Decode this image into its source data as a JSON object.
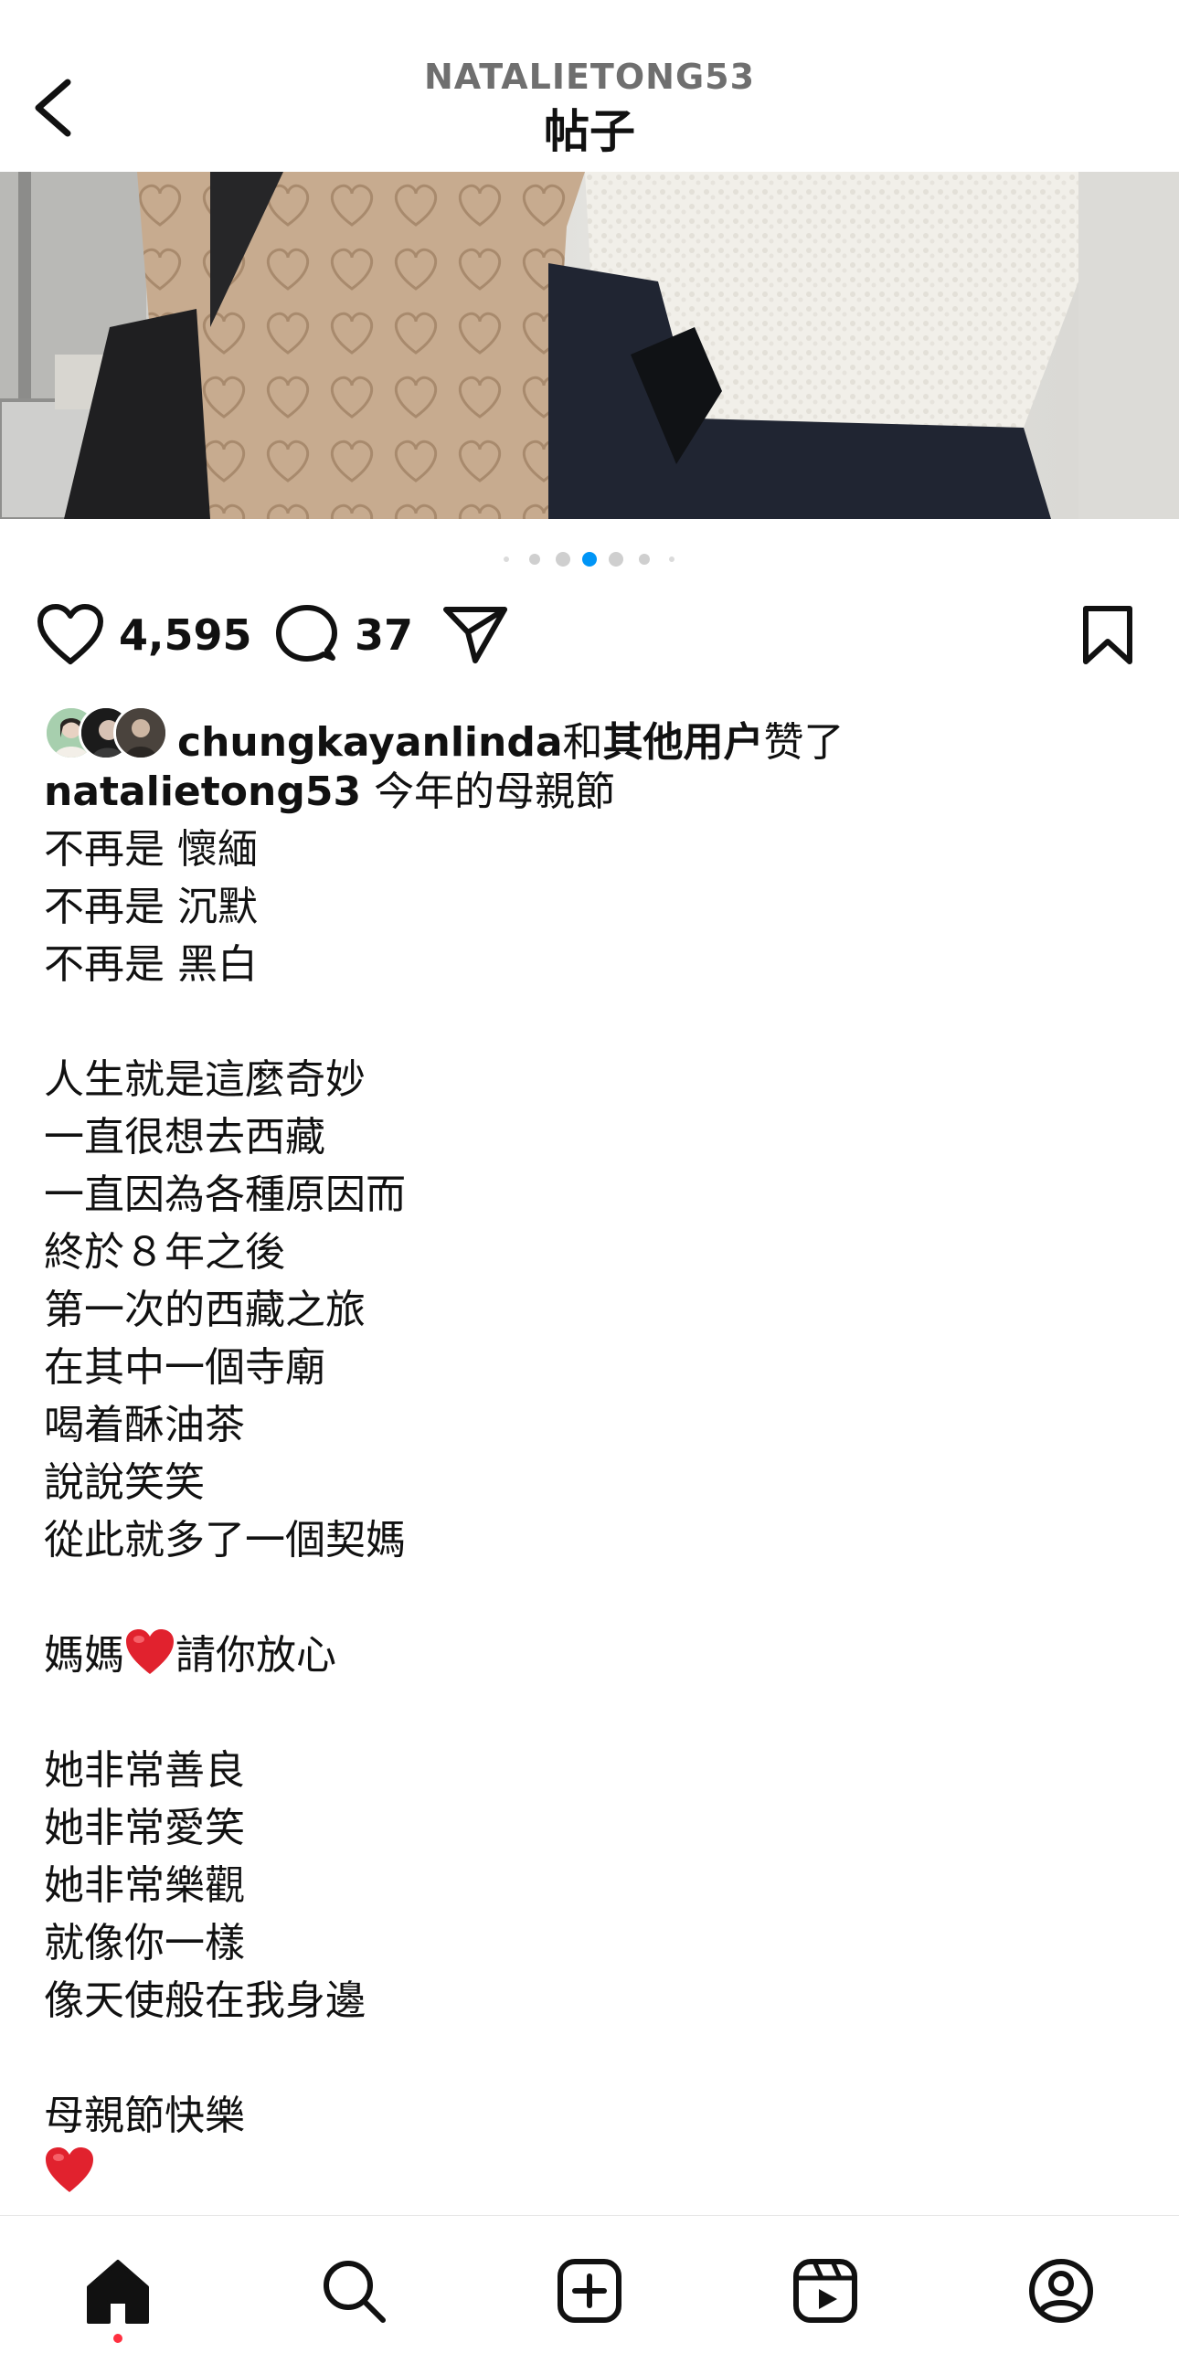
{
  "header": {
    "username": "NATALIETONG53",
    "title": "帖子",
    "back_icon": "chevron-left-icon"
  },
  "carousel": {
    "dot_count": 7,
    "active_index": 3,
    "accent": "#0095f6"
  },
  "actions": {
    "like_count": "4,595",
    "comment_count": "37",
    "icons": [
      "heart-icon",
      "comment-icon",
      "share-icon",
      "bookmark-icon"
    ]
  },
  "likes": {
    "user": "chungkayanlinda",
    "connector": "和",
    "others": "其他用户",
    "suffix": "赞了"
  },
  "caption": {
    "username": "natalietong53",
    "first_line": "今年的母親節",
    "lines": [
      "不再是 懷緬",
      "不再是 沉默",
      "不再是 黑白",
      "",
      "人生就是這麼奇妙",
      "一直很想去西藏",
      "一直因為各種原因而",
      "終於８年之後",
      "第一次的西藏之旅",
      "在其中一個寺廟",
      "喝着酥油茶",
      "說說笑笑",
      "從此就多了一個契媽",
      "",
      "媽媽",
      "",
      "她非常善良",
      "她非常愛笑",
      "她非常樂觀",
      "就像你一樣",
      "像天使般在我身邊",
      "",
      "母親節快樂"
    ],
    "mama_suffix": "請你放心",
    "heart_emoji": "red-heart-icon"
  },
  "bottom_nav": {
    "items": [
      "home-icon",
      "search-icon",
      "create-icon",
      "reels-icon",
      "profile-icon"
    ],
    "notification_color": "#ff3040"
  }
}
